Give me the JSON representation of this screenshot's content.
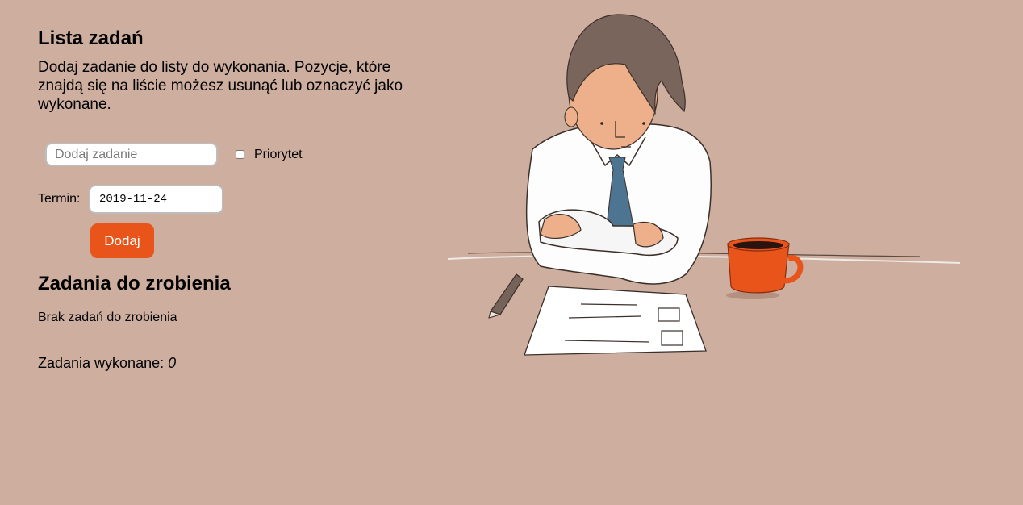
{
  "header": {
    "title": "Lista zadań",
    "intro": "Dodaj zadanie do listy do wykonania. Pozycje, które znajdą się na liście możesz usunąć lub oznaczyć jako wykonane."
  },
  "form": {
    "task_placeholder": "Dodaj zadanie",
    "priority_label": "Priorytet",
    "priority_checked": false,
    "date_label": "Termin:",
    "date_value": "2019-11-24",
    "add_label": "Dodaj"
  },
  "todo": {
    "heading": "Zadania do zrobienia",
    "empty_text": "Brak zadań do zrobienia"
  },
  "done": {
    "label": "Zadania wykonane: ",
    "count": "0"
  },
  "colors": {
    "background": "#cdae9f",
    "accent": "#e8541a"
  }
}
